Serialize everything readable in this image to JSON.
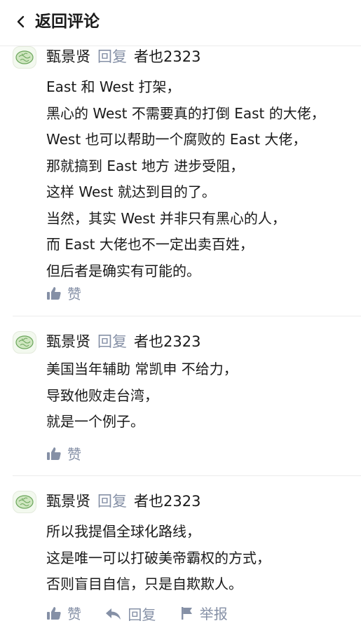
{
  "header": {
    "title": "返回评论"
  },
  "comments": [
    {
      "author": "甄景贤",
      "reply_word": "回复",
      "target": "者也2323",
      "lines": [
        "East 和 West 打架，",
        "黑心的 West 不需要真的打倒 East 的大佬，",
        "West 也可以帮助一个腐败的 East 大佬，",
        "那就搞到 East 地方 进步受阻，",
        "这样 West 就达到目的了。",
        "当然，其实 West 并非只有黑心的人，",
        "而 East 大佬也不一定出卖百姓，",
        "但后者是确实有可能的。"
      ],
      "actions": {
        "like": "赞"
      }
    },
    {
      "author": "甄景贤",
      "reply_word": "回复",
      "target": "者也2323",
      "lines": [
        "美国当年辅助 常凯申 不给力，",
        "导致他败走台湾，",
        "就是一个例子。"
      ],
      "actions": {
        "like": "赞"
      }
    },
    {
      "author": "甄景贤",
      "reply_word": "回复",
      "target": "者也2323",
      "lines": [
        "所以我提倡全球化路线，",
        "这是唯一可以打破美帝霸权的方式，",
        "否则盲目自信，只是自欺欺人。"
      ],
      "actions": {
        "like": "赞",
        "reply": "回复",
        "report": "举报"
      }
    }
  ],
  "colors": {
    "secondary": "#8590a6",
    "text": "#1a1a1a",
    "divider": "#ececec"
  }
}
